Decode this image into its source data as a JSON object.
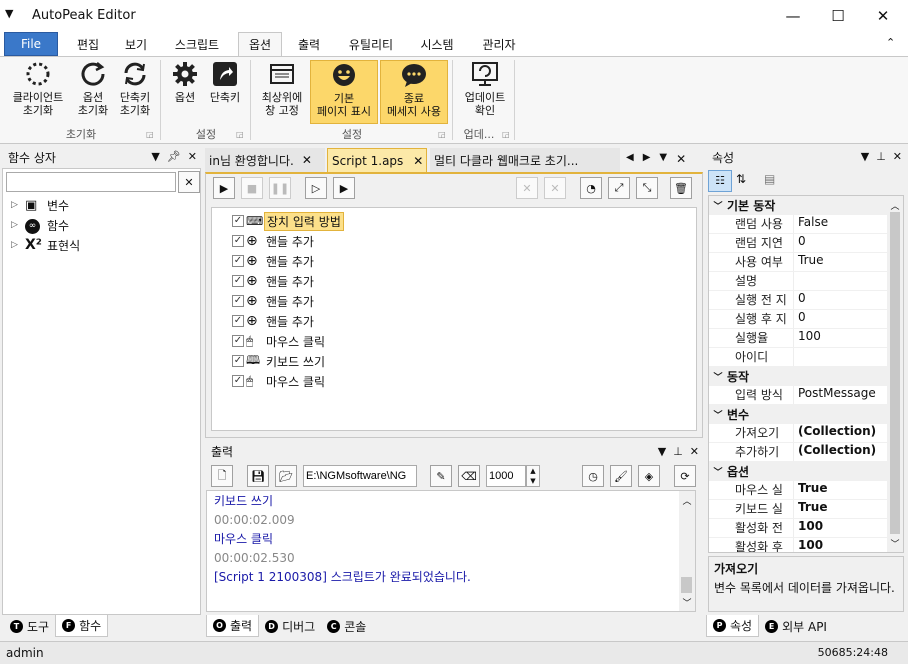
{
  "app": {
    "title": "AutoPeak Editor"
  },
  "menu": {
    "tabs": [
      "File",
      "편집",
      "보기",
      "스크립트",
      "옵션",
      "출력",
      "유틸리티",
      "시스템",
      "관리자"
    ]
  },
  "ribbon": {
    "buttons": [
      {
        "label1": "클라이언트",
        "label2": "초기화"
      },
      {
        "label1": "옵션",
        "label2": "초기화"
      },
      {
        "label1": "단축키",
        "label2": "초기화"
      },
      {
        "label1": "옵션",
        "label2": ""
      },
      {
        "label1": "단축키",
        "label2": ""
      },
      {
        "label1": "최상위에",
        "label2": "창 고정"
      },
      {
        "label1": "기본",
        "label2": "페이지 표시"
      },
      {
        "label1": "종료",
        "label2": "메세지 사용"
      },
      {
        "label1": "업데이트",
        "label2": "확인"
      }
    ],
    "groups": [
      "초기화",
      "설정",
      "설정",
      "업데..."
    ]
  },
  "function_box": {
    "title": "함수 상자",
    "search_value": "",
    "items": [
      "변수",
      "함수",
      "표현식"
    ]
  },
  "doc_tabs": [
    "in님 환영합니다.",
    "Script 1.aps",
    "멀티 다클라 웹매크로 초기..."
  ],
  "script": {
    "items": [
      "장치 입력 방법",
      "핸들 추가",
      "핸들 추가",
      "핸들 추가",
      "핸들 추가",
      "핸들 추가",
      "마우스 클릭",
      "키보드 쓰기",
      "마우스 클릭"
    ]
  },
  "output": {
    "title": "출력",
    "path": "E:\\NGMsoftware\\NG",
    "count": "1000",
    "lines": [
      {
        "text": "키보드 쓰기",
        "color": "#1a1aa8"
      },
      {
        "text": "00:00:02.009",
        "color": "#888888"
      },
      {
        "text": "마우스 클릭",
        "color": "#1a1aa8"
      },
      {
        "text": "00:00:02.530",
        "color": "#888888"
      },
      {
        "text": "[Script 1 2100308] 스크립트가 완료되었습니다.",
        "color": "#1a1aa8"
      }
    ]
  },
  "properties": {
    "title": "속성",
    "categories": [
      {
        "name": "기본 동작",
        "rows": [
          {
            "name": "랜덤 사용",
            "value": "False",
            "bold": false
          },
          {
            "name": "랜덤 지연",
            "value": "0",
            "bold": false
          },
          {
            "name": "사용 여부",
            "value": "True",
            "bold": false
          },
          {
            "name": "설명",
            "value": "",
            "bold": false
          },
          {
            "name": "실행 전 지",
            "value": "0",
            "bold": false
          },
          {
            "name": "실행 후 지",
            "value": "0",
            "bold": false
          },
          {
            "name": "실행율",
            "value": "100",
            "bold": false
          },
          {
            "name": "아이디",
            "value": "",
            "bold": false
          }
        ]
      },
      {
        "name": "동작",
        "rows": [
          {
            "name": "입력 방식",
            "value": "PostMessage",
            "bold": false
          }
        ]
      },
      {
        "name": "변수",
        "rows": [
          {
            "name": "가져오기",
            "value": "(Collection)",
            "bold": true
          },
          {
            "name": "추가하기",
            "value": "(Collection)",
            "bold": true
          }
        ]
      },
      {
        "name": "옵션",
        "rows": [
          {
            "name": "마우스 실",
            "value": "True",
            "bold": true
          },
          {
            "name": "키보드 실",
            "value": "True",
            "bold": true
          },
          {
            "name": "활성화 전",
            "value": "100",
            "bold": true
          },
          {
            "name": "활성화 후",
            "value": "100",
            "bold": true
          }
        ]
      }
    ],
    "desc_title": "가져오기",
    "desc_text": "변수 목록에서 데이터를 가져옵니다."
  },
  "bottom_tabs": {
    "left": [
      {
        "key": "T",
        "label": "도구"
      },
      {
        "key": "F",
        "label": "함수"
      }
    ],
    "center": [
      {
        "key": "O",
        "label": "출력"
      },
      {
        "key": "D",
        "label": "디버그"
      },
      {
        "key": "C",
        "label": "콘솔"
      }
    ],
    "right": [
      {
        "key": "P",
        "label": "속성"
      },
      {
        "key": "E",
        "label": "외부 API"
      }
    ]
  },
  "status": {
    "user": "admin",
    "clock": "50685:24:48"
  },
  "colors": {
    "accent": "#3a78c9",
    "highlight": "#fcd76a",
    "output_blue": "#1a1aa8"
  }
}
